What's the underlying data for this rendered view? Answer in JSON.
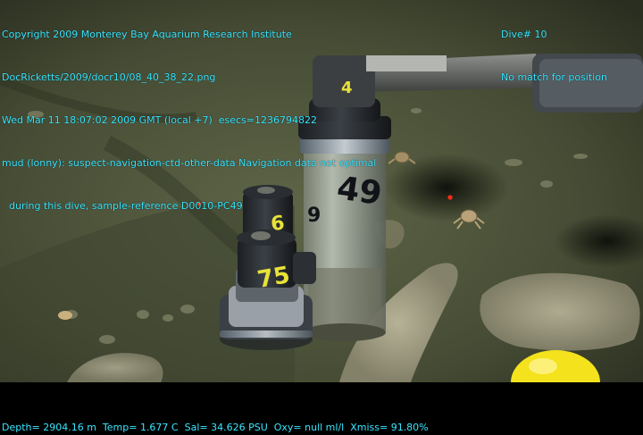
{
  "overlay": {
    "left_lines": [
      "Copyright 2009 Monterey Bay Aquarium Research Institute",
      "DocRicketts/2009/docr10/08_40_38_22.png",
      "Wed Mar 11 18:07:02 2009 GMT (local +7)  esecs=1236794822",
      "mud (lonny): suspect-navigation-ctd-other-data Navigation data not optimal",
      "during this dive, sample-reference D0010-PC49"
    ],
    "right_lines": [
      "Dive# 10",
      "No match for position"
    ],
    "bottom_line": "Depth= 2904.16 m  Temp= 1.677 C  Sal= 34.626 PSU  Oxy= null ml/l  Xmiss= 91.80%"
  },
  "scene": {
    "core_labels": [
      "49",
      "9",
      "6",
      "75",
      "4"
    ],
    "colors": {
      "overlay_text": "#38e6ff",
      "seafloor": "#4b5238",
      "laser_dot": "#ff2a1a",
      "yellow_buoy": "#f3e21c"
    }
  }
}
